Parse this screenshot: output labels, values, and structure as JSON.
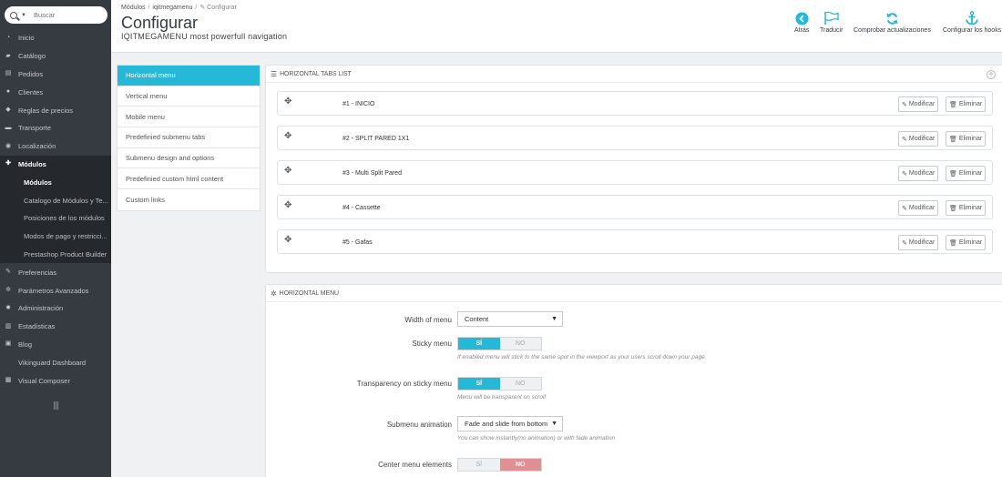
{
  "search": {
    "placeholder": "Buscar"
  },
  "sidebar": {
    "items": [
      {
        "icon": "dashboard-icon",
        "label": "Inicio"
      },
      {
        "icon": "catalog-icon",
        "label": "Catálogo"
      },
      {
        "icon": "orders-icon",
        "label": "Pedidos"
      },
      {
        "icon": "customers-icon",
        "label": "Clientes"
      },
      {
        "icon": "price-rules-icon",
        "label": "Reglas de precios"
      },
      {
        "icon": "truck-icon",
        "label": "Transporte"
      },
      {
        "icon": "globe-icon",
        "label": "Localización"
      },
      {
        "icon": "puzzle-icon",
        "label": "Módulos"
      }
    ],
    "submenu": [
      "Módulos",
      "Catalogo de Módulos y Te...",
      "Posiciones de los módulos",
      "Modos de pago y restricci...",
      "Prestashop Product Builder"
    ],
    "items_after": [
      {
        "icon": "wrench-icon",
        "label": "Preferencias"
      },
      {
        "icon": "cogs-icon",
        "label": "Parámetros Avanzados"
      },
      {
        "icon": "gear-icon",
        "label": "Administración"
      },
      {
        "icon": "stats-icon",
        "label": "Estadísticas"
      },
      {
        "icon": "blog-icon",
        "label": "Blog"
      },
      {
        "icon": "",
        "label": "Vikinguard Dashboard"
      },
      {
        "icon": "composer-icon",
        "label": "Visual Composer"
      }
    ]
  },
  "breadcrumb": {
    "first": "Módulos",
    "second": "iqitmegamenu",
    "third": "Configurar"
  },
  "page": {
    "title": "Configurar",
    "subtitle": "IQITMEGAMENU most powerfull navigation"
  },
  "toolbar": {
    "back": "Atrás",
    "translate": "Traducir",
    "check_updates": "Comprobar actualizaciones",
    "configure_hooks": "Configurar los hooks"
  },
  "tabs": [
    "Horizontal menu",
    "Vertical menu",
    "Mobile menu",
    "Predefinied submenu tabs",
    "Submenu design and options",
    "Predefinied custom html content",
    "Custom links"
  ],
  "tabs_panel": {
    "heading": "HORIZONTAL TABS LIST",
    "rows": [
      "#1 - INICIO",
      "#2 - SPLIT PARED 1X1",
      "#3 - Multi Split Pared",
      "#4 - Cassette",
      "#5 - Gafas"
    ],
    "edit_label": "Modificar",
    "delete_label": "Eliminar"
  },
  "horizontal_panel": {
    "heading": "HORIZONTAL MENU",
    "width_label": "Width of menu",
    "width_value": "Content",
    "sticky_label": "Sticky menu",
    "sticky_help": "If enabled menu will stick to the same spot in the viewport as your users scroll down your page.",
    "transparency_label": "Transparency on sticky menu",
    "transparency_help": "Menu will be transparent on scroll",
    "animation_label": "Submenu animation",
    "animation_value": "Fade and slide from bottom",
    "animation_help": "You can show instantly(no animation) or with fade animation",
    "center_label": "Center menu elements",
    "yes": "SÍ",
    "no": "NO"
  },
  "colors": {
    "accent": "#25b9d7",
    "sidebar": "#363a41",
    "no_active": "#e08f95"
  }
}
